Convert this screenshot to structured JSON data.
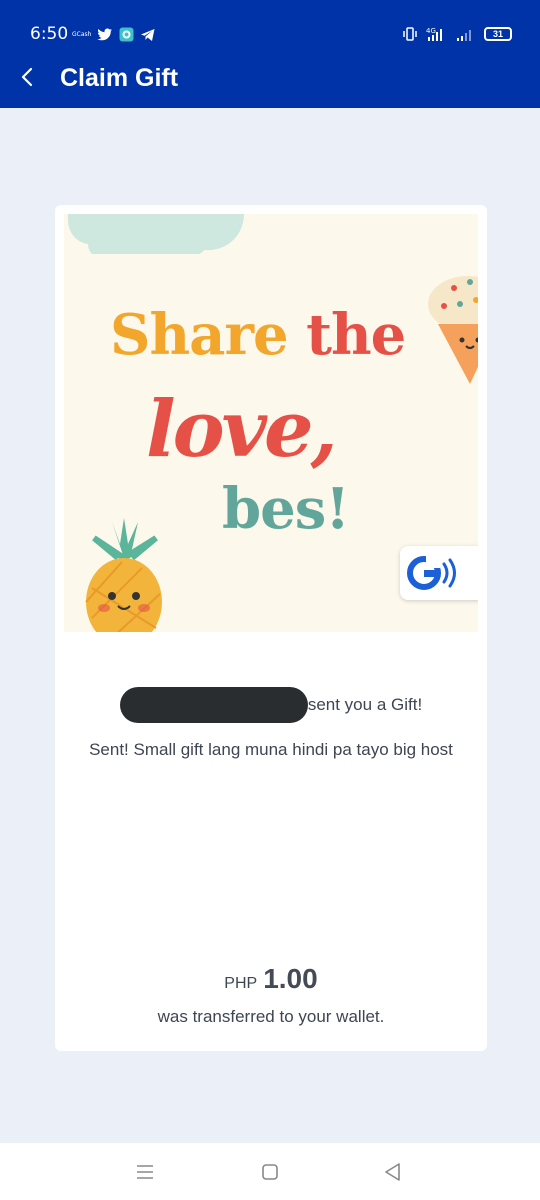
{
  "status_bar": {
    "time": "6:50",
    "notification_label": "GCash",
    "network_label": "4G",
    "battery": "31"
  },
  "header": {
    "title": "Claim Gift",
    "back_icon": "back-arrow-icon"
  },
  "banner": {
    "line1_part1": "Share",
    "line1_part2": "the",
    "line2": "love,",
    "line3": "bes!"
  },
  "gift": {
    "sender_suffix": "sent you a Gift!",
    "message": "Sent! Small gift lang muna hindi pa tayo big host",
    "currency": "PHP",
    "amount": "1.00",
    "transfer_note": "was transferred to your wallet."
  },
  "colors": {
    "brand_blue": "#0033a8",
    "background": "#eaeff8",
    "headline_orange": "#f2a62c",
    "headline_red": "#e65147",
    "headline_teal": "#62a69b"
  }
}
